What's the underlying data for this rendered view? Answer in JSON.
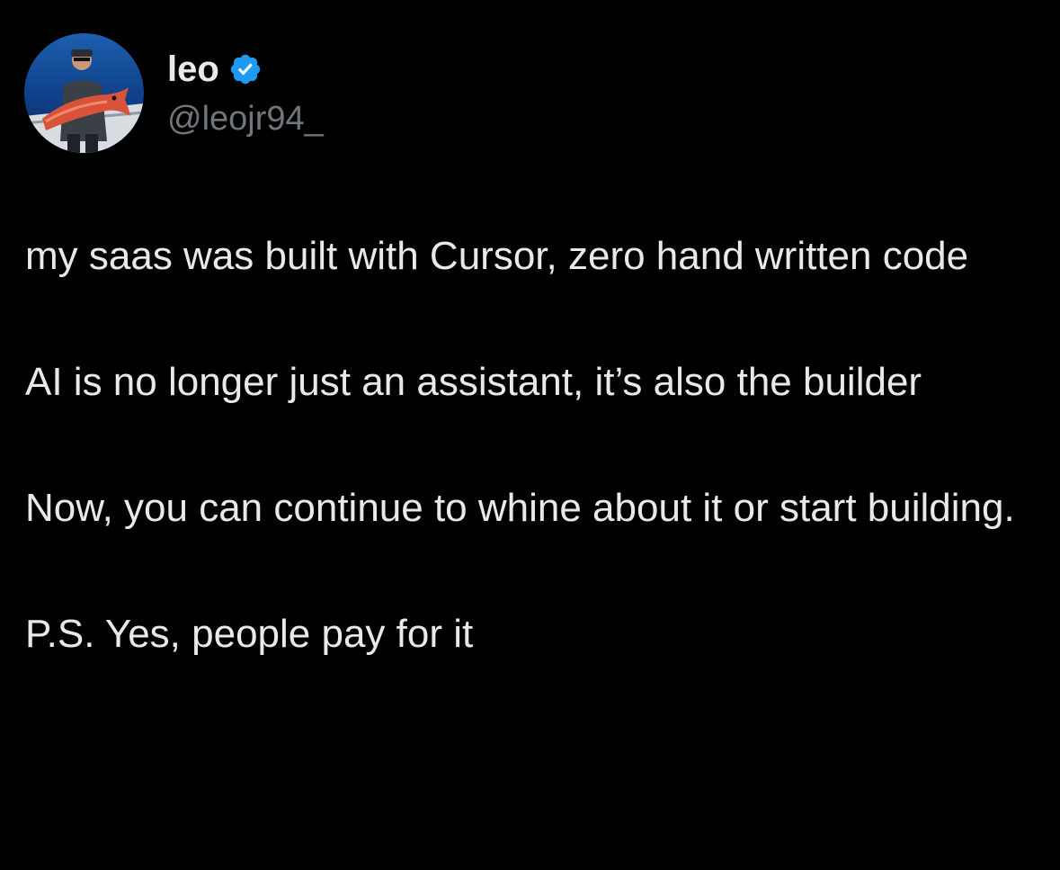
{
  "user": {
    "display_name": "leo",
    "handle": "@leojr94_",
    "verified": true,
    "verified_color": "#1d9bf0",
    "avatar_icon": "avatar-photo-fisherman-with-fish"
  },
  "tweet": {
    "paragraphs": [
      "my saas was built with Cursor, zero hand written code",
      "AI is no longer just an assistant, it’s also the builder",
      "Now, you can continue to whine about it or start building.",
      "P.S. Yes, people pay for it"
    ]
  },
  "colors": {
    "background": "#000000",
    "text": "#e7e9ea",
    "secondary_text": "#71767b"
  }
}
